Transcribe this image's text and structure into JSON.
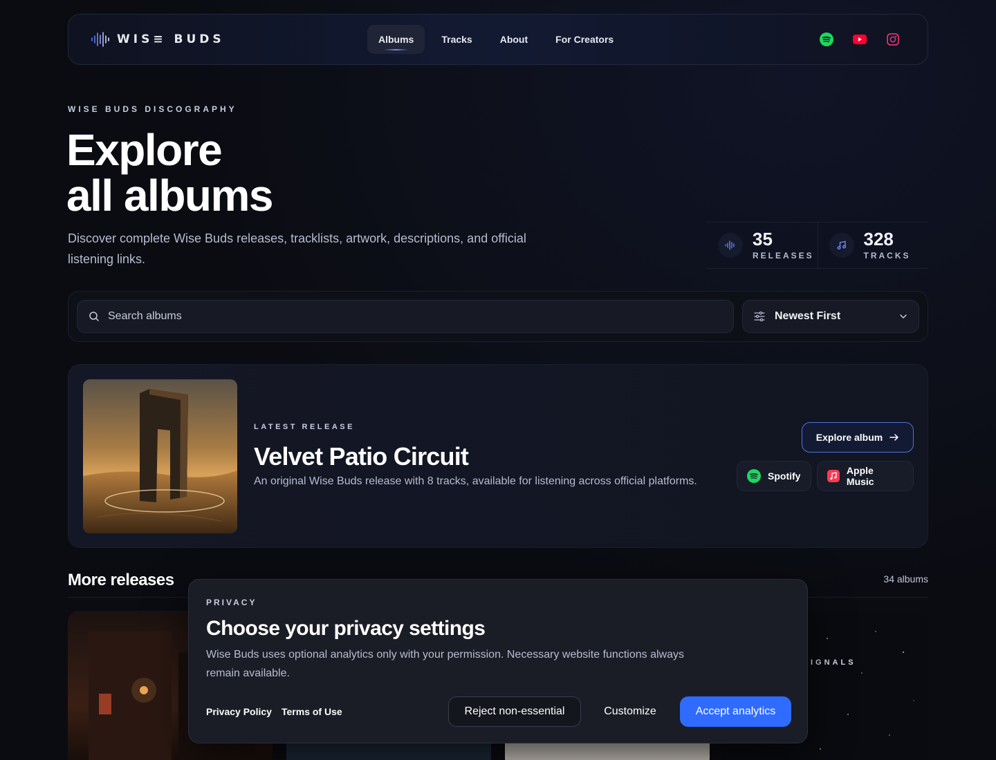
{
  "brand": {
    "name": "WIS≡ BUDS"
  },
  "nav": {
    "items": [
      {
        "label": "Albums",
        "active": true
      },
      {
        "label": "Tracks"
      },
      {
        "label": "About"
      },
      {
        "label": "For Creators"
      }
    ]
  },
  "socials": [
    {
      "name": "spotify-icon",
      "color": "#1ed760"
    },
    {
      "name": "youtube-icon",
      "color": "#ff0033"
    },
    {
      "name": "instagram-icon",
      "color": "#e1306c"
    }
  ],
  "hero": {
    "eyebrow": "WISE BUDS DISCOGRAPHY",
    "title_line1": "Explore",
    "title_line2": "all albums",
    "subtitle": "Discover complete Wise Buds releases, tracklists, artwork, descriptions, and official listening links."
  },
  "stats": [
    {
      "value": "35",
      "label": "RELEASES",
      "icon": "waveform-icon"
    },
    {
      "value": "328",
      "label": "TRACKS",
      "icon": "music-note-icon"
    }
  ],
  "search": {
    "placeholder": "Search albums",
    "value": ""
  },
  "sort": {
    "selected": "Newest First"
  },
  "latest": {
    "eyebrow": "LATEST RELEASE",
    "title": "Velvet Patio Circuit",
    "description": "An original Wise Buds release with 8 tracks, available for listening across official platforms.",
    "explore_label": "Explore album",
    "spotify_label": "Spotify",
    "apple_label": "Apple Music"
  },
  "more": {
    "title": "More releases",
    "count": "34 albums",
    "partial_label": "IGNALS"
  },
  "privacy": {
    "eyebrow": "PRIVACY",
    "title": "Choose your privacy settings",
    "text": "Wise Buds uses optional analytics only with your permission. Necessary website functions always remain available.",
    "policy_link": "Privacy Policy",
    "terms_link": "Terms of Use",
    "reject_label": "Reject non-essential",
    "customize_label": "Customize",
    "accept_label": "Accept analytics"
  },
  "colors": {
    "accent": "#2f6bff",
    "background": "#0b0c12"
  }
}
